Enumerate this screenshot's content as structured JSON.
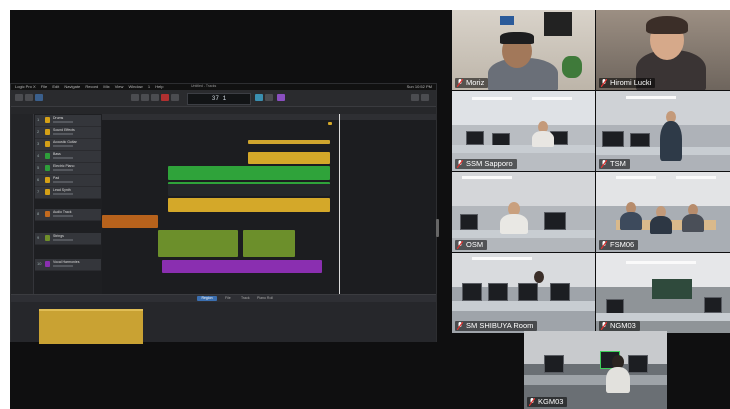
{
  "screen_share": {
    "menu_items": [
      "Logic Pro X",
      "File",
      "Edit",
      "Navigate",
      "Record",
      "Mix",
      "View",
      "Window",
      "1",
      "Help"
    ],
    "window_title": "Untitled - Tracks",
    "clock": "Sun 10:52 PM",
    "lcd_value": "37  1",
    "editor_tabs": {
      "active": "Region",
      "others": [
        "File",
        "Track",
        "Piano Roll"
      ]
    },
    "tracks": [
      {
        "num": "1",
        "name": "Drums",
        "color": "#d4a017"
      },
      {
        "num": "2",
        "name": "Sound Effects",
        "color": "#d4a017"
      },
      {
        "num": "3",
        "name": "Acoustic Guitar",
        "color": "#d4a017"
      },
      {
        "num": "4",
        "name": "Bass",
        "color": "#2e9e3a"
      },
      {
        "num": "5",
        "name": "Electric Piano",
        "color": "#2e9e3a"
      },
      {
        "num": "6",
        "name": "Pad",
        "color": "#d4a017"
      },
      {
        "num": "7",
        "name": "Lead Synth",
        "color": "#d4a017"
      },
      {
        "num": "8",
        "name": "Audio Track",
        "color": "#c36a1e"
      },
      {
        "num": "9",
        "name": "Strings",
        "color": "#6f8f2a"
      },
      {
        "num": "10",
        "name": "Vocal Harmonies",
        "color": "#8a2fb0"
      }
    ]
  },
  "gallery": {
    "participants": [
      {
        "name": "Moriz",
        "active": true
      },
      {
        "name": "Hiromi Lucki",
        "active": false
      },
      {
        "name": "SSM Sapporo",
        "active": false
      },
      {
        "name": "TSM",
        "active": false
      },
      {
        "name": "OSM",
        "active": false
      },
      {
        "name": "FSM06",
        "active": false
      },
      {
        "name": "SM SHIBUYA Room",
        "active": false
      },
      {
        "name": "NGM03",
        "active": false
      },
      {
        "name": "KGM03",
        "active": false
      }
    ]
  },
  "colors": {
    "active_speaker": "#3ecf5a",
    "mic_muted": "#e0322f",
    "background": "#0f0f10"
  }
}
